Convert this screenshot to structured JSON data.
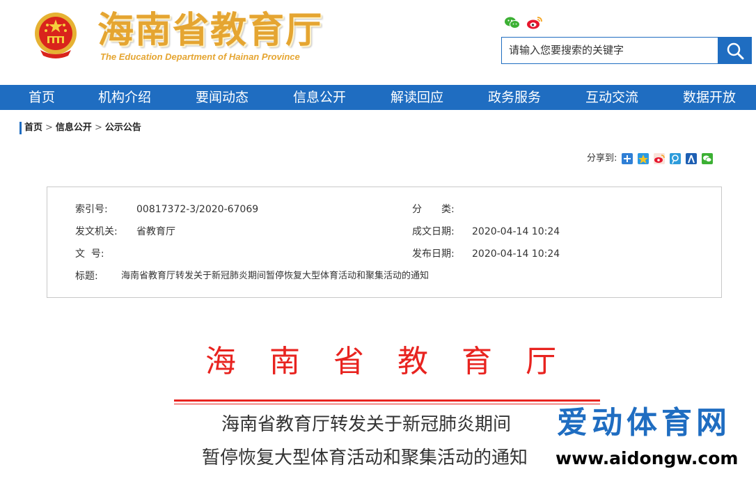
{
  "header": {
    "site_title": "海南省教育厅",
    "site_subtitle": "The Education Department of Hainan Province",
    "search_placeholder": "请输入您要搜索的关键字",
    "colors": {
      "brand_blue": "#1f6dc1",
      "title_gold": "#e5a531",
      "emblem_red": "#d9241c"
    },
    "social_icons": [
      "wechat-icon",
      "weibo-icon"
    ]
  },
  "nav": {
    "items": [
      "首页",
      "机构介绍",
      "要闻动态",
      "信息公开",
      "解读回应",
      "政务服务",
      "互动交流",
      "数据开放"
    ]
  },
  "breadcrumb": {
    "items": [
      "首页",
      "信息公开",
      "公示公告"
    ],
    "separator": ">"
  },
  "share": {
    "label": "分享到:",
    "icons": [
      "qzone-share-icon",
      "qq-space-share-icon",
      "weibo-share-icon",
      "tencent-weibo-share-icon",
      "renren-share-icon",
      "wechat-share-icon"
    ]
  },
  "info": {
    "index_label": "索引号:",
    "index_value": "00817372-3/2020-67069",
    "category_label": "分　　类:",
    "category_value": "",
    "issuer_label": "发文机关:",
    "issuer_value": "省教育厅",
    "created_label": "成文日期:",
    "created_value": "2020-04-14 10:24",
    "docno_label": "文  号:",
    "docno_value": "",
    "published_label": "发布日期:",
    "published_value": "2020-04-14 10:24",
    "title_label": "标题:",
    "title_value": "海南省教育厅转发关于新冠肺炎期间暂停恢复大型体育活动和聚集活动的通知"
  },
  "document": {
    "header": "海南省教育厅",
    "title_line1": "海南省教育厅转发关于新冠肺炎期间",
    "title_line2": "暂停恢复大型体育活动和聚集活动的通知",
    "color_red": "#e8231f"
  },
  "watermark": {
    "text": "爱动体育网",
    "url": "www.aidongw.com"
  }
}
